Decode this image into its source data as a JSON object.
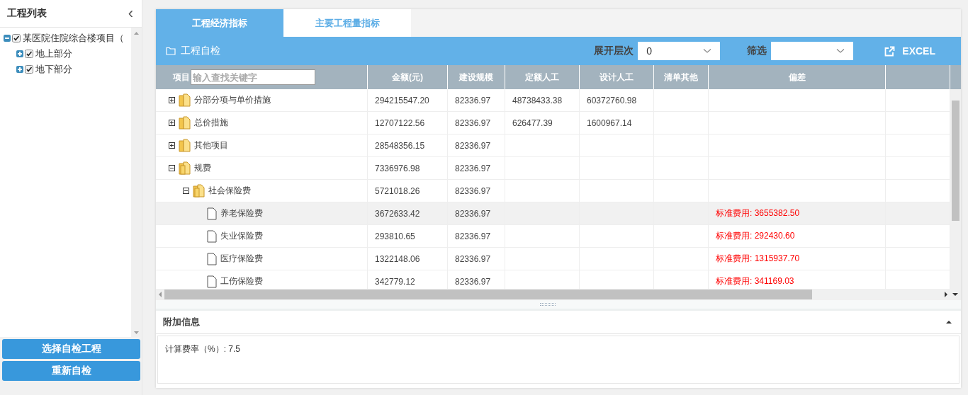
{
  "sidebar": {
    "title": "工程列表",
    "collapse_icon": "‹",
    "tree": [
      {
        "label": "某医院住院综合楼项目（",
        "checked": true,
        "expanded": true,
        "children": [
          {
            "label": "地上部分",
            "checked": true,
            "expanded": false
          },
          {
            "label": "地下部分",
            "checked": true,
            "expanded": false
          }
        ]
      }
    ],
    "buttons": [
      "选择自检工程",
      "重新自检"
    ]
  },
  "tabs": [
    {
      "label": "工程经济指标",
      "selected": true
    },
    {
      "label": "主要工程量指标",
      "selected": false
    }
  ],
  "toolbar": {
    "title": "工程自检",
    "expand_level": {
      "label": "展开层次",
      "value": "0"
    },
    "filter": {
      "label": "筛选"
    },
    "export": "EXCEL"
  },
  "table": {
    "columns": [
      "项目",
      "金额(元)",
      "建设规模",
      "定额人工",
      "设计人工",
      "清单其他",
      "偏差"
    ],
    "search": {
      "placeholder": "输入查找关键字"
    },
    "rows": [
      {
        "kind": "folder",
        "name": "分部分项与单价措施",
        "amount": "294215547.20",
        "scale": "82336.97",
        "quota_labor": "48738433.38",
        "design_labor": "60372760.98",
        "expanded": false,
        "selected": false
      },
      {
        "kind": "folder",
        "name": "总价措施",
        "amount": "12707122.56",
        "scale": "82336.97",
        "quota_labor": "626477.39",
        "design_labor": "1600967.14",
        "expanded": false,
        "selected": false
      },
      {
        "kind": "folder",
        "name": "其他项目",
        "amount": "28548356.15",
        "scale": "82336.97",
        "expanded": false,
        "selected": false
      },
      {
        "kind": "folder",
        "name": "规费",
        "amount": "7336976.98",
        "scale": "82336.97",
        "expanded": true,
        "selected": false,
        "children": [
          {
            "kind": "folder",
            "name": "社会保险费",
            "amount": "5721018.26",
            "scale": "82336.97",
            "expanded": true,
            "selected": false,
            "children": [
              {
                "kind": "file",
                "name": "养老保险费",
                "amount": "3672633.42",
                "scale": "82336.97",
                "deviation": "标准费用: 3655382.50",
                "selected": true
              },
              {
                "kind": "file",
                "name": "失业保险费",
                "amount": "293810.65",
                "scale": "82336.97",
                "deviation": "标准费用: 292430.60",
                "selected": false
              },
              {
                "kind": "file",
                "name": "医疗保险费",
                "amount": "1322148.06",
                "scale": "82336.97",
                "deviation": "标准费用: 1315937.70",
                "selected": false
              },
              {
                "kind": "file",
                "name": "工伤保险费",
                "amount": "342779.12",
                "scale": "82336.97",
                "deviation": "标准费用: 341169.03",
                "selected": false
              }
            ]
          }
        ]
      }
    ]
  },
  "extra_info": {
    "title": "附加信息",
    "expanded": true,
    "content": "计算费率（%）: 7.5"
  }
}
